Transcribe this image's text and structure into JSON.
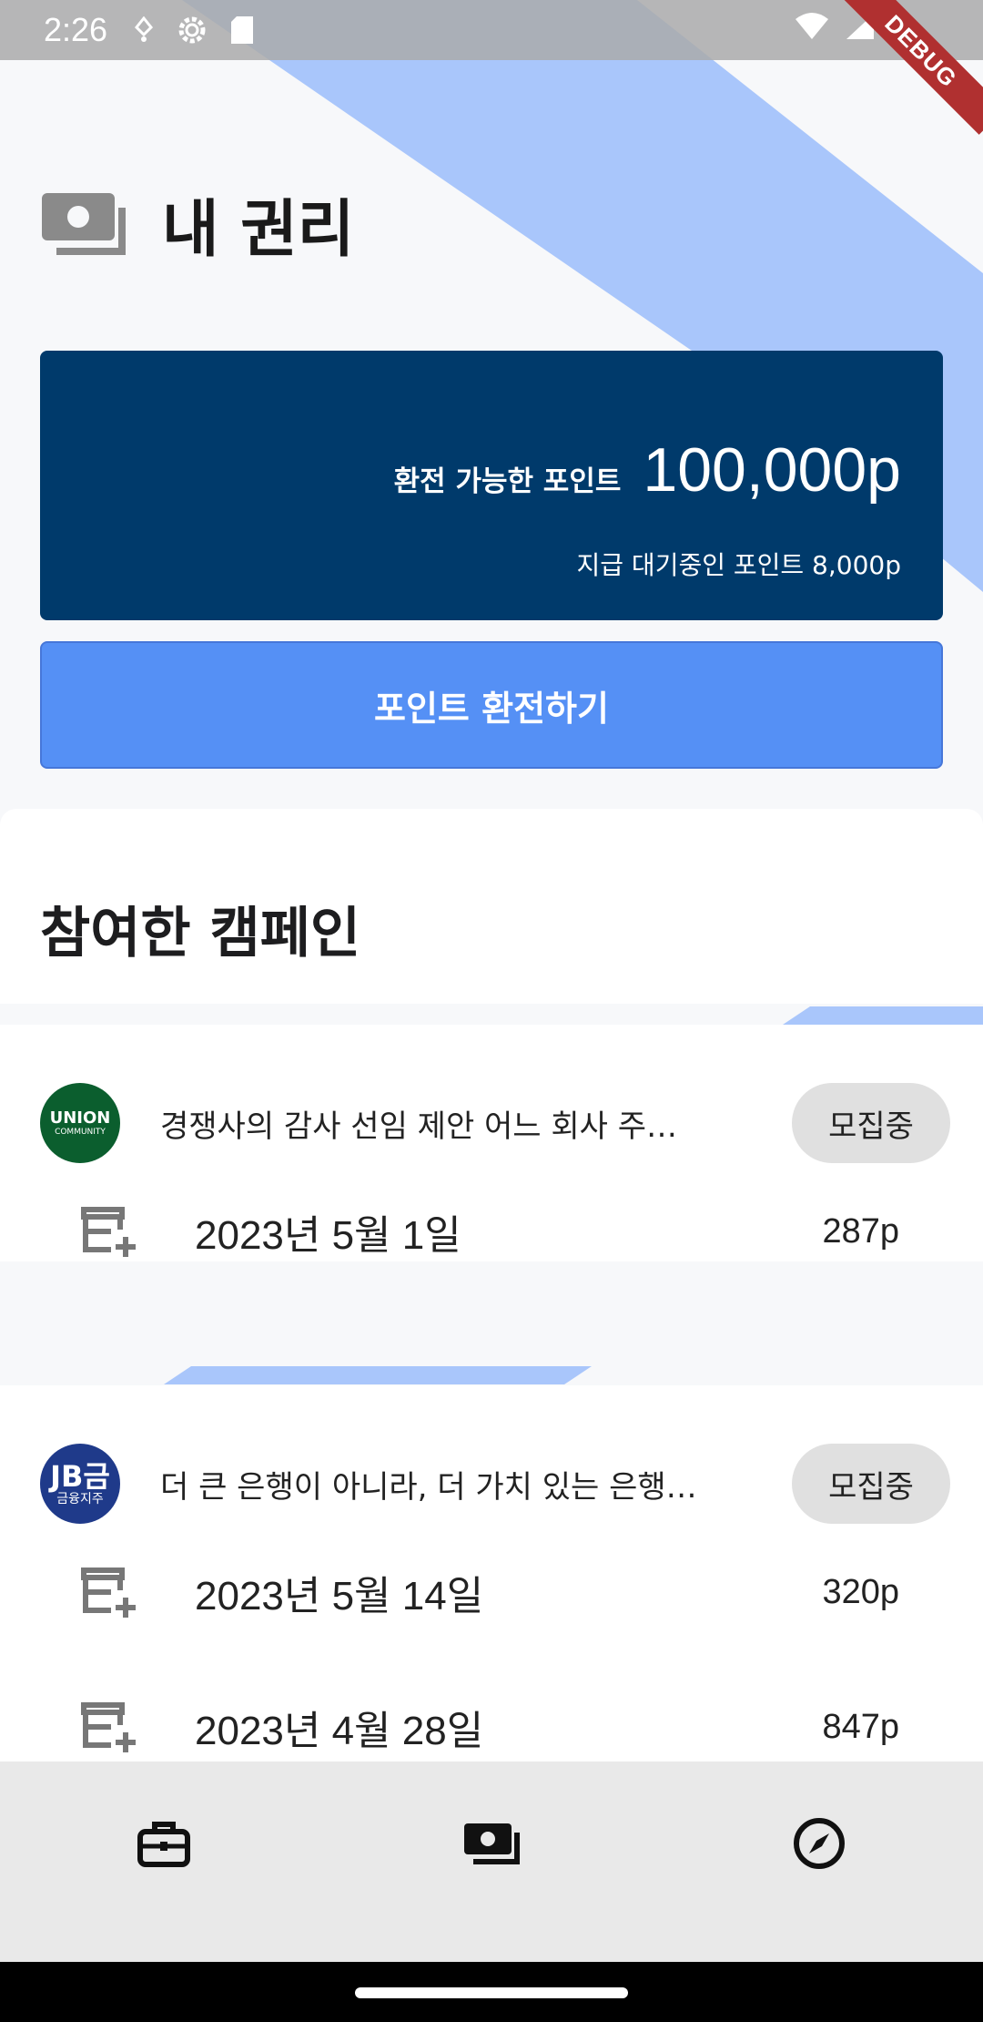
{
  "status_bar": {
    "time": "2:26",
    "debug": "DEBUG"
  },
  "header": {
    "title": "내 권리",
    "icon": "points-wallet-icon"
  },
  "points": {
    "label": "환전 가능한 포인트",
    "value": "100,000p",
    "pending": "지급 대기중인 포인트 8,000p"
  },
  "exchange_button": "포인트 환전하기",
  "campaigns": {
    "heading": "참여한 캠페인",
    "items": [
      {
        "logo_text": "UNION",
        "logo_subtext": "COMMUNITY",
        "logo_color": "#0b5e2e",
        "title": "경쟁사의 감사 선임 제안 어느 회사 주…",
        "status": "모집중",
        "entries": [
          {
            "date": "2023년 5월 1일",
            "points": "287p"
          }
        ]
      },
      {
        "logo_text": "JB금",
        "logo_subtext": "금융지주",
        "logo_color": "#1f3a8a",
        "title": "더 큰 은행이 아니라, 더 가치 있는 은행…",
        "status": "모집중",
        "entries": [
          {
            "date": "2023년 5월 14일",
            "points": "320p"
          },
          {
            "date": "2023년 4월 28일",
            "points": "847p"
          }
        ]
      }
    ]
  },
  "nav": {
    "items": [
      {
        "icon": "briefcase-icon"
      },
      {
        "icon": "points-wallet-icon",
        "active": true
      },
      {
        "icon": "compass-icon"
      }
    ]
  },
  "colors": {
    "accent": "#5590f5",
    "card": "#003a6b",
    "stripe": "#a9c6fb"
  }
}
